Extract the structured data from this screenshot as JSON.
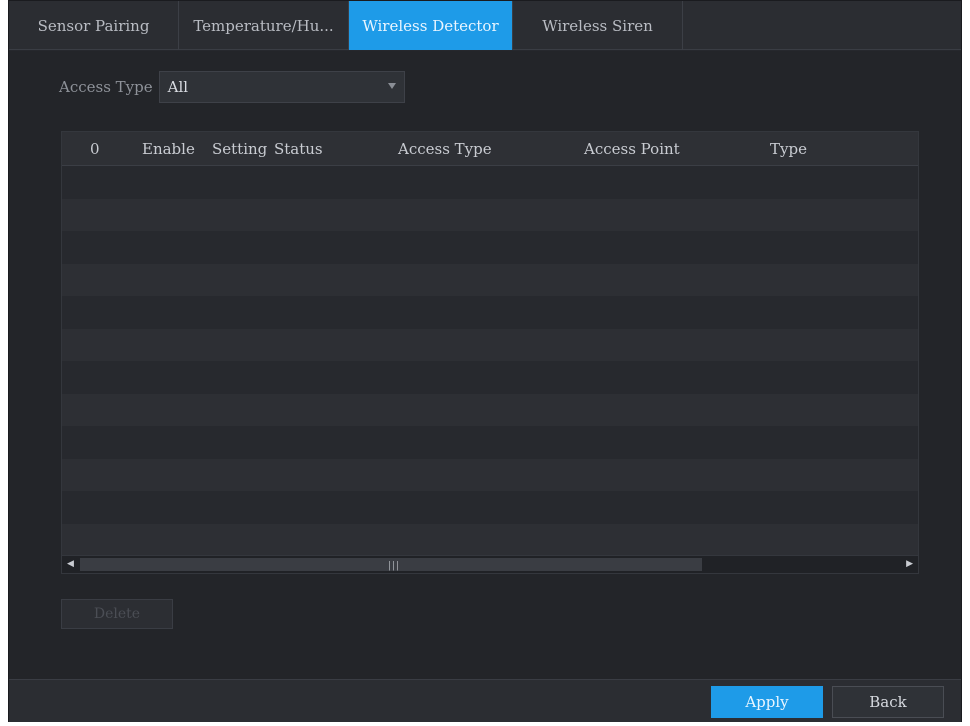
{
  "tabs": [
    {
      "label": "Sensor Pairing",
      "active": false
    },
    {
      "label": "Temperature/Hu...",
      "active": false
    },
    {
      "label": "Wireless Detector",
      "active": true
    },
    {
      "label": "Wireless Siren",
      "active": false
    }
  ],
  "filter": {
    "label": "Access Type",
    "selected": "All"
  },
  "table": {
    "columns": [
      "0",
      "Enable",
      "Setting",
      "Status",
      "Access Type",
      "Access Point",
      "Type"
    ],
    "rows": []
  },
  "scrollbar": {
    "grip": "|||"
  },
  "buttons": {
    "delete": "Delete",
    "apply": "Apply",
    "back": "Back"
  },
  "colors": {
    "accent": "#1e9be8",
    "background": "#232529"
  }
}
